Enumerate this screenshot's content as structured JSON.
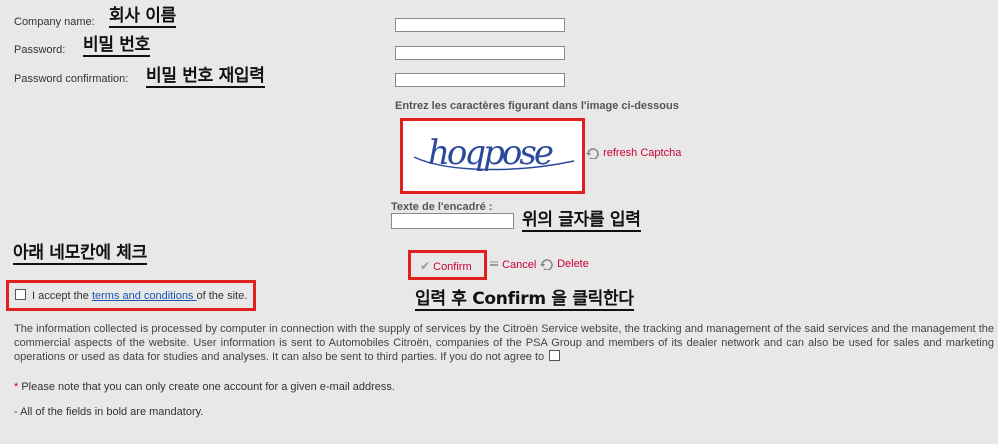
{
  "form": {
    "company_label": "Company name:",
    "password_label": "Password:",
    "password_confirm_label": "Password confirmation:",
    "company_value": "",
    "password_value": "",
    "password_confirm_value": ""
  },
  "annotations": {
    "company_kr": "회사 이름",
    "password_kr": "비밀 번호",
    "password_confirm_kr": "비밀 번호 재입력",
    "captcha_input_kr": "위의 글자를 입력",
    "checkbox_kr": "아래 네모칸에 체크",
    "confirm_kr": "입력 후 Confirm 을 클릭한다"
  },
  "captcha": {
    "instruction": "Entrez les caractères figurant dans l'image ci-dessous",
    "image_text": "hoqpose",
    "refresh_label": "refresh Captcha",
    "input_label": "Texte de l'encadré :",
    "input_value": ""
  },
  "actions": {
    "confirm_label": "Confirm",
    "cancel_label": "Cancel",
    "delete_label": "Delete"
  },
  "terms": {
    "prefix": "I accept the ",
    "link_text": "terms and conditions ",
    "suffix": "of the site."
  },
  "notice": {
    "paragraph": "The information collected is processed by computer in connection with the supply of services by the Citroën Service website, the tracking and management of the said services and the management the commercial aspects of the website. User information is sent to Automobiles Citroën, companies of the PSA Group and members of its dealer network and can also be used for sales and marketing operations or used as data for studies and analyses. It can also be sent to third parties. If you do not agree to",
    "asterisk": "*",
    "one_account": " Please note that you can only create one account for a given e-mail address.",
    "dash": "-",
    "mandatory": " All of the fields in bold are mandatory."
  },
  "colors": {
    "background": "#e8e8e8",
    "highlight_red": "#e0201e",
    "link_red": "#cc0033",
    "link_blue": "#1a55b0"
  }
}
